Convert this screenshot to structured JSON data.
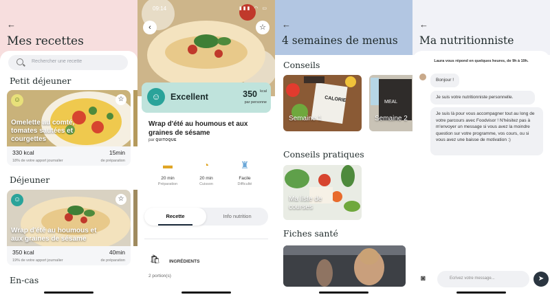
{
  "recipes": {
    "title": "Mes recettes",
    "search_placeholder": "Rechercher une recette",
    "sections": [
      "Petit déjeuner",
      "Déjeuner",
      "En-cas"
    ],
    "cards": [
      {
        "title": "Omelette au comté, tomates sautées et courgettes",
        "kcal": "330 kcal",
        "kcal_sub": "18% de votre apport journalier",
        "time": "15min",
        "time_sub": "de préparation"
      },
      {
        "title": "Wrap d'été au houmous et aux graines de sésame",
        "kcal": "350 kcal",
        "kcal_sub": "19% de votre apport journalier",
        "time": "40min",
        "time_sub": "de préparation"
      }
    ]
  },
  "recipe_detail": {
    "status_time": "09:14",
    "score_label": "Excellent",
    "kcal_value": "350",
    "kcal_unit": "kcal",
    "kcal_per": "par personne",
    "title": "Wrap d'été au houmous et aux graines de sésame",
    "by": "par",
    "brand": "QUITOQUE",
    "meta": [
      {
        "value": "20 min",
        "label": "Préparation"
      },
      {
        "value": "20 min",
        "label": "Cuisson"
      },
      {
        "value": "Facile",
        "label": "Difficulté"
      }
    ],
    "tabs": [
      "Recette",
      "Info nutrition"
    ],
    "ingredients_label": "INGRÉDIENTS",
    "portions": "2 portion(s)"
  },
  "menus": {
    "title": "4 semaines de menus",
    "sections": [
      "Conseils",
      "Conseils pratiques",
      "Fiches santé"
    ],
    "weeks": [
      "Semaine 1",
      "Semaine 2"
    ],
    "practical": "Ma liste de courses",
    "calorie_sign": "CALORIE",
    "meal_sign": "MEAL"
  },
  "nutritionist": {
    "title": "Ma nutritionniste",
    "intro": "Laura vous répond en quelques heures, de 9h à 19h.",
    "messages": [
      "Bonjour !",
      "Je suis votre nutritionniste personnelle.",
      "Je suis là pour vous accompagner tout au long de votre parcours avec Foodvisor ! N'hésitez pas à m'envoyer un message si vous avez la moindre question sur votre programme, vos cours, ou si vous avez une baisse de motivation :)"
    ],
    "input_placeholder": "Ecrivez votre message..."
  }
}
